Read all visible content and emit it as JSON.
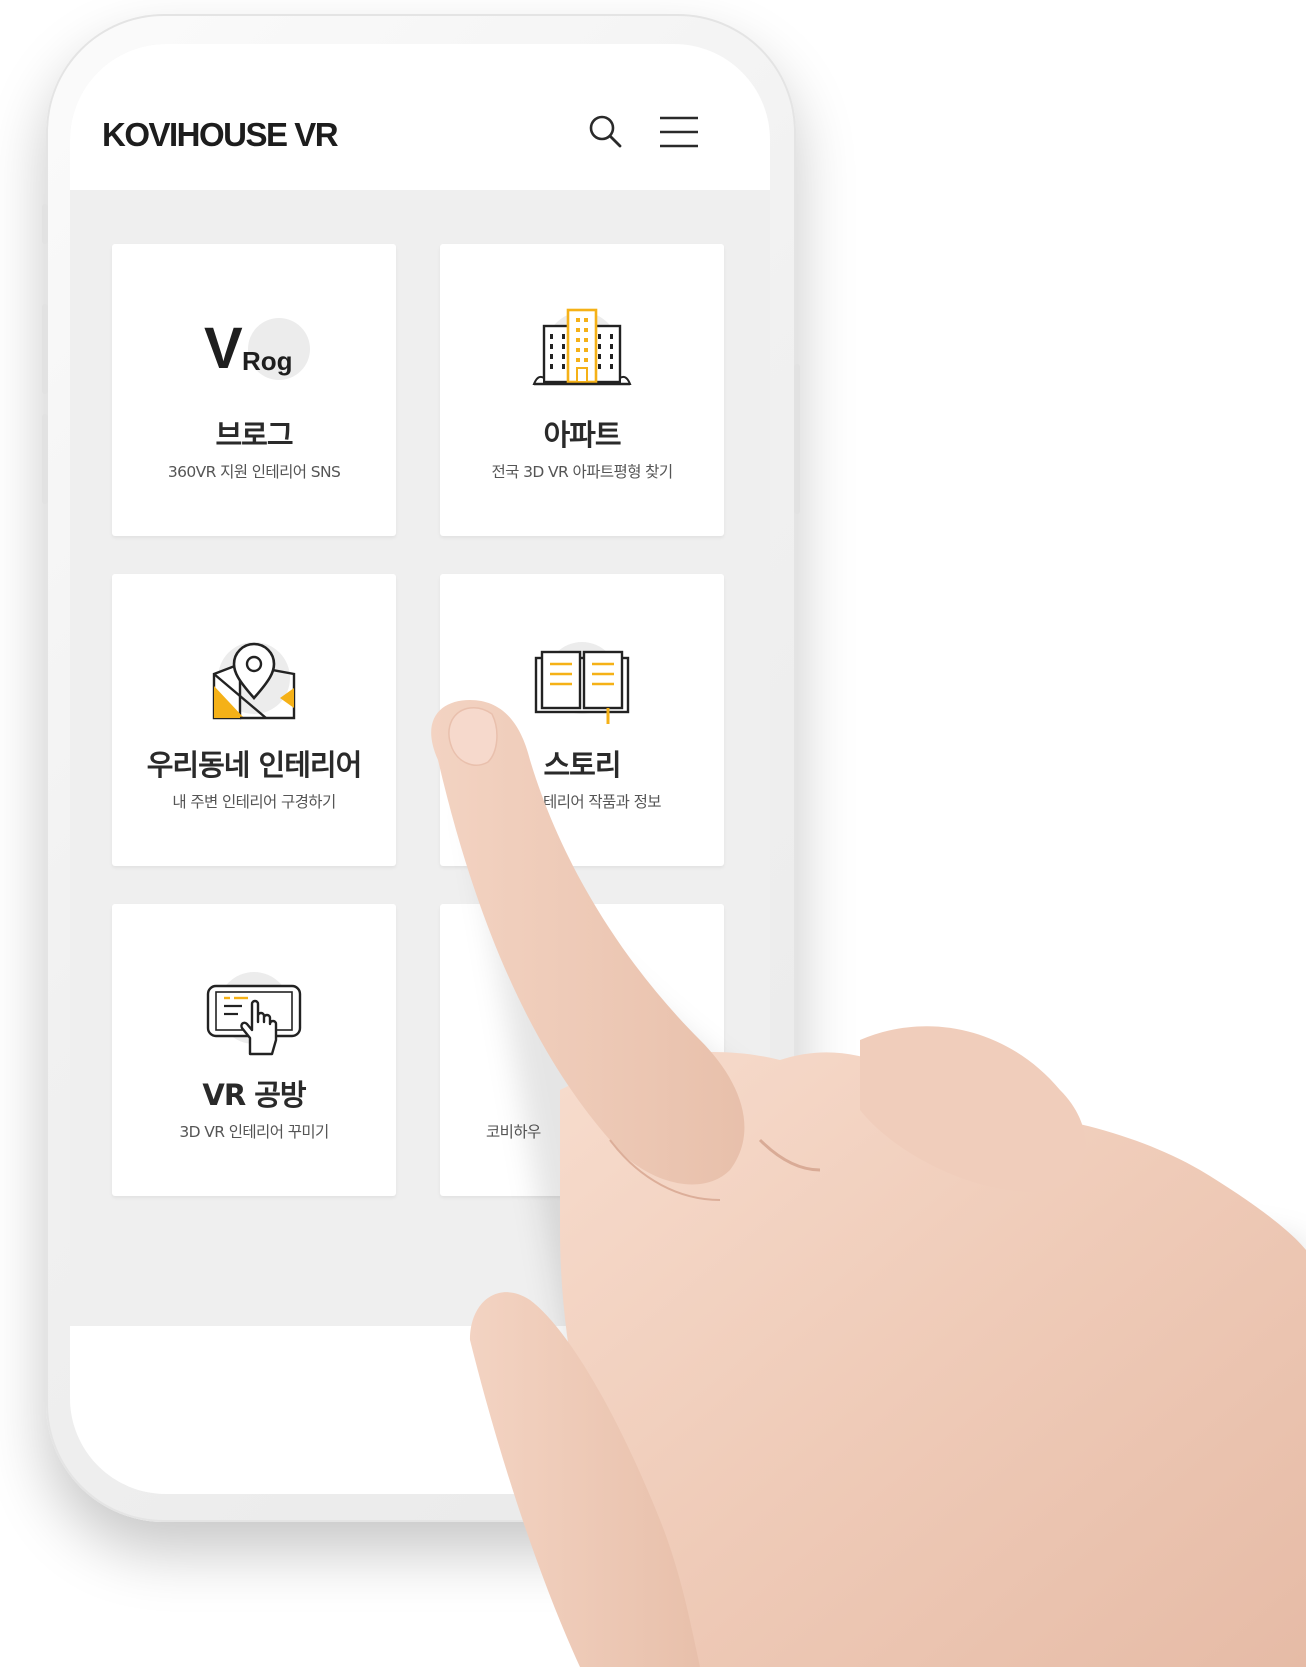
{
  "app": {
    "title": "KOVIHOUSE VR"
  },
  "header": {
    "search_icon": "search-icon",
    "menu_icon": "hamburger-menu-icon"
  },
  "cards": [
    {
      "icon": "vrog-logo-icon",
      "logo_text_big": "V",
      "logo_text_small": "Rog",
      "title": "브로그",
      "subtitle": "360VR 지원 인테리어 SNS"
    },
    {
      "icon": "apartment-building-icon",
      "title": "아파트",
      "subtitle": "전국 3D VR 아파트평형 찾기"
    },
    {
      "icon": "map-pin-icon",
      "title": "우리동네 인테리어",
      "subtitle": "내 주변 인테리어 구경하기"
    },
    {
      "icon": "open-book-icon",
      "title": "스토리",
      "subtitle": "테리어 작품과 정보"
    },
    {
      "icon": "tablet-touch-icon",
      "title": "VR 공방",
      "subtitle": "3D VR 인테리어 꾸미기"
    },
    {
      "icon": "hidden-icon",
      "title": "",
      "subtitle": "코비하우"
    }
  ],
  "colors": {
    "accent": "#f5b117",
    "background": "#efefef",
    "card": "#ffffff",
    "text_dark": "#2a2a2a",
    "text_sub": "#555555"
  }
}
